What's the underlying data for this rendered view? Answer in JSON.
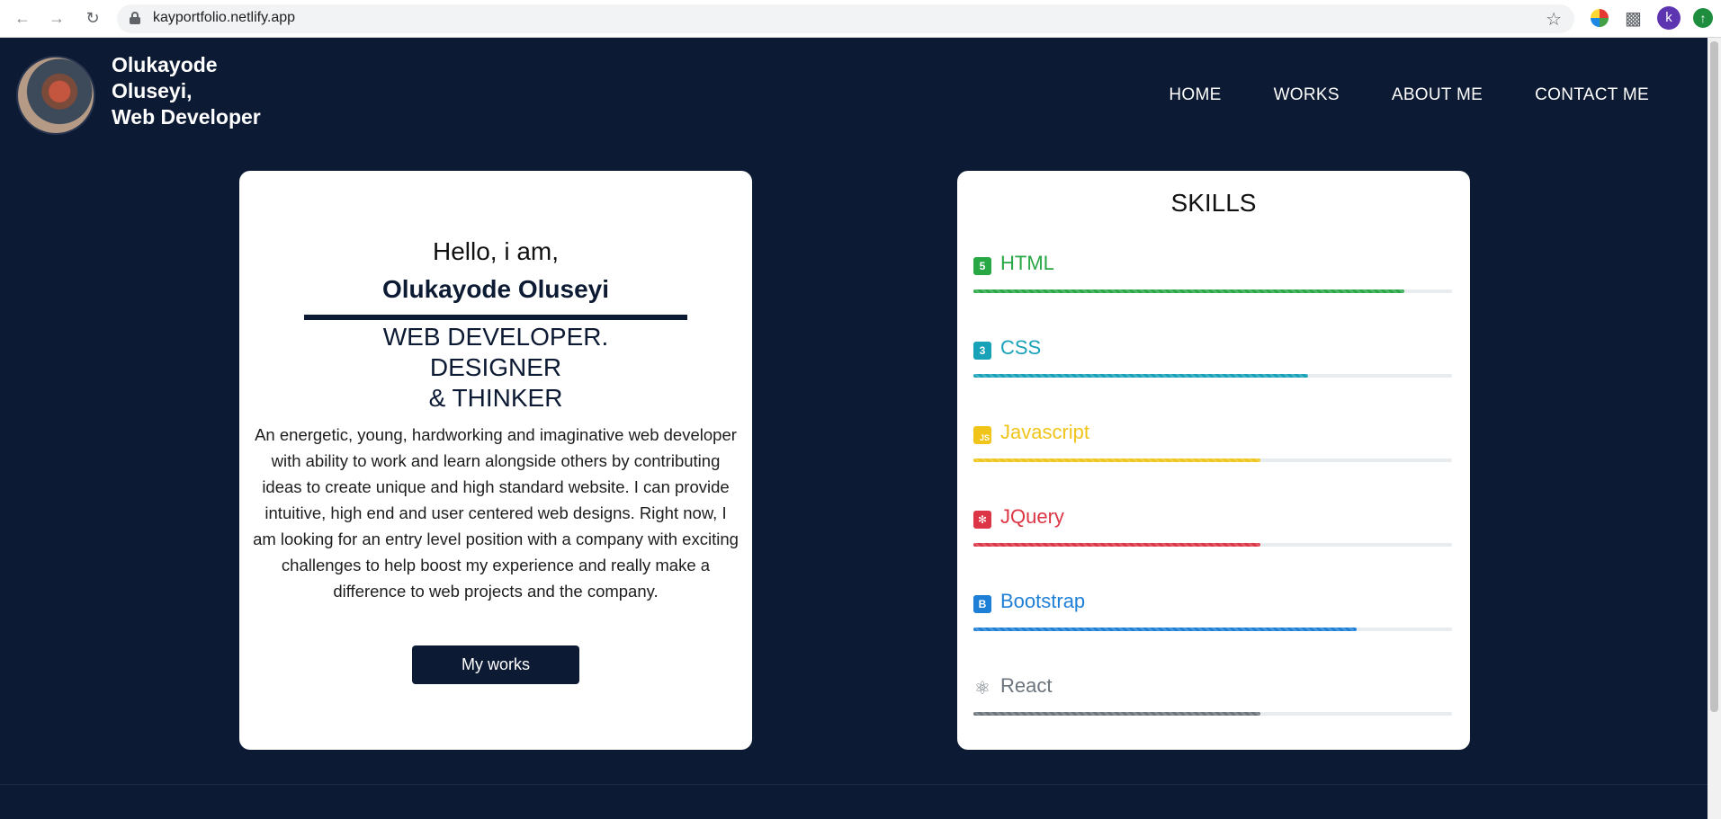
{
  "browser": {
    "url": "kayportfolio.netlify.app",
    "profile_initial": "k"
  },
  "header": {
    "brand_lines": [
      "Olukayode",
      "Oluseyi,",
      "Web Developer"
    ],
    "nav": [
      "HOME",
      "WORKS",
      "ABOUT ME",
      "CONTACT ME"
    ]
  },
  "intro": {
    "greeting": "Hello, i am,",
    "name": "Olukayode Oluseyi",
    "roles": [
      "WEB DEVELOPER.",
      "DESIGNER",
      "& THINKER"
    ],
    "bio": "An energetic, young, hardworking and imaginative web developer with ability to work and learn alongside others by contributing ideas to create unique and high standard website. I can provide intuitive, high end and user centered web designs. Right now, I am looking for an entry level position with a company with exciting challenges to help boost my experience and really make a difference to web projects and the company.",
    "button": "My works"
  },
  "skills": {
    "title": "SKILLS",
    "items": [
      {
        "name": "HTML",
        "icon": "html5-icon",
        "color": "#28a745",
        "level": 0.9
      },
      {
        "name": "CSS",
        "icon": "css3-icon",
        "color": "#17a2b8",
        "level": 0.7
      },
      {
        "name": "Javascript",
        "icon": "js-icon",
        "color": "#f0c419",
        "level": 0.6
      },
      {
        "name": "JQuery",
        "icon": "jquery-icon",
        "color": "#dc3545",
        "level": 0.6
      },
      {
        "name": "Bootstrap",
        "icon": "bootstrap-icon",
        "color": "#1e7fd6",
        "level": 0.8
      },
      {
        "name": "React",
        "icon": "react-icon",
        "color": "#6c757d",
        "level": 0.6
      }
    ]
  }
}
